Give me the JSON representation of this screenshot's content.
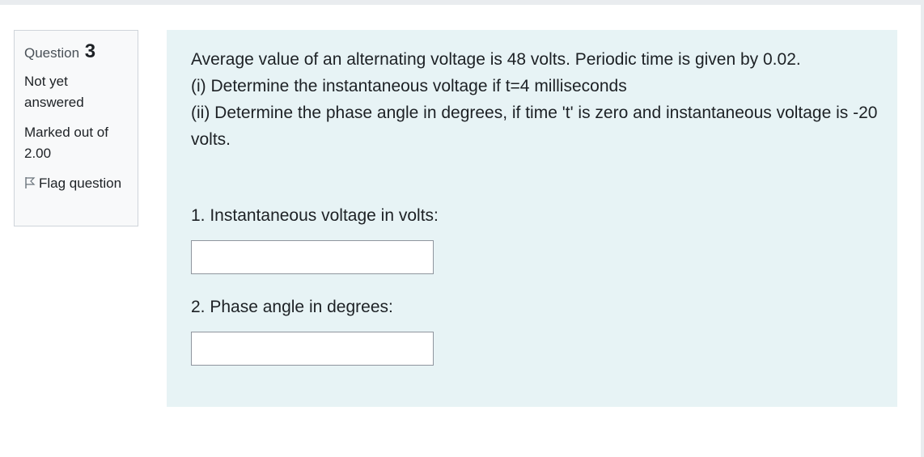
{
  "info": {
    "question_label": "Question",
    "question_number": "3",
    "state": "Not yet answered",
    "grade": "Marked out of 2.00",
    "flag_label": "Flag question",
    "flag_icon": "flag-outline-icon"
  },
  "question": {
    "line1": "Average value of an alternating voltage is 48 volts. Periodic time is given by 0.02.",
    "line2": "(i) Determine the instantaneous voltage if t=4 milliseconds",
    "line3": "(ii) Determine the phase angle in degrees, if time 't' is zero and instantaneous voltage is -20 volts."
  },
  "parts": [
    {
      "label": "1. Instantaneous voltage in volts:",
      "value": ""
    },
    {
      "label": "2. Phase angle in degrees:",
      "value": ""
    }
  ],
  "colors": {
    "content_bg": "#e7f3f5",
    "info_bg": "#f8f9fa",
    "border": "#cfd4da"
  }
}
